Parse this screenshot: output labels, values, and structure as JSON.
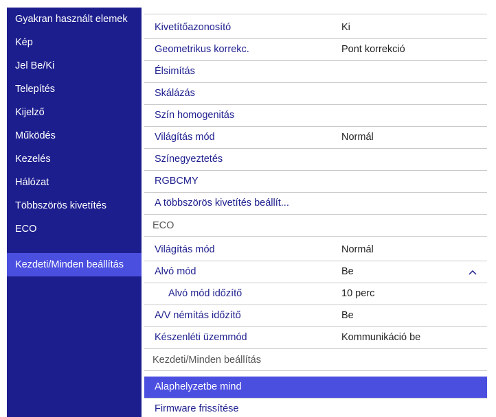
{
  "sidebar": {
    "items": [
      {
        "label": "Gyakran használt elemek"
      },
      {
        "label": "Kép"
      },
      {
        "label": "Jel Be/Ki"
      },
      {
        "label": "Telepítés"
      },
      {
        "label": "Kijelző"
      },
      {
        "label": "Működés"
      },
      {
        "label": "Kezelés"
      },
      {
        "label": "Hálózat"
      },
      {
        "label": "Többszörös kivetítés"
      },
      {
        "label": "ECO"
      },
      {
        "label": "Kezdeti/Minden beállítás",
        "selected": true
      }
    ]
  },
  "panel": {
    "rows_group1": [
      {
        "label": "Kivetítőazonosító",
        "value": "Ki"
      },
      {
        "label": "Geometrikus korrekc.",
        "value": "Pont korrekció"
      },
      {
        "label": "Élsimítás",
        "value": ""
      },
      {
        "label": "Skálázás",
        "value": ""
      },
      {
        "label": "Szín homogenitás",
        "value": ""
      },
      {
        "label": "Világítás mód",
        "value": "Normál"
      },
      {
        "label": "Színegyeztetés",
        "value": ""
      },
      {
        "label": "RGBCMY",
        "value": ""
      },
      {
        "label": "A többszörös kivetítés beállít...",
        "value": ""
      }
    ],
    "eco_header": "ECO",
    "rows_eco": [
      {
        "label": "Világítás mód",
        "value": "Normál"
      },
      {
        "label": "Alvó mód",
        "value": "Be",
        "icon": "chevron-up-icon"
      },
      {
        "label": "Alvó mód időzítő",
        "value": "10 perc"
      },
      {
        "label": "A/V némítás időzítő",
        "value": "Be"
      },
      {
        "label": "Készenléti üzemmód",
        "value": "Kommunikáció be"
      }
    ],
    "init_header": "Kezdeti/Minden beállítás",
    "rows_init": [
      {
        "label": "Alaphelyzetbe mind",
        "highlighted": true
      },
      {
        "label": "Firmware frissítése"
      }
    ]
  },
  "colors": {
    "sidebar_bg": "#1d1e8e",
    "selected_bg": "#4b4fe0",
    "label_text": "#1d1e8e",
    "value_text": "#222222",
    "section_text": "#555555",
    "divider": "#c9c9c9"
  }
}
